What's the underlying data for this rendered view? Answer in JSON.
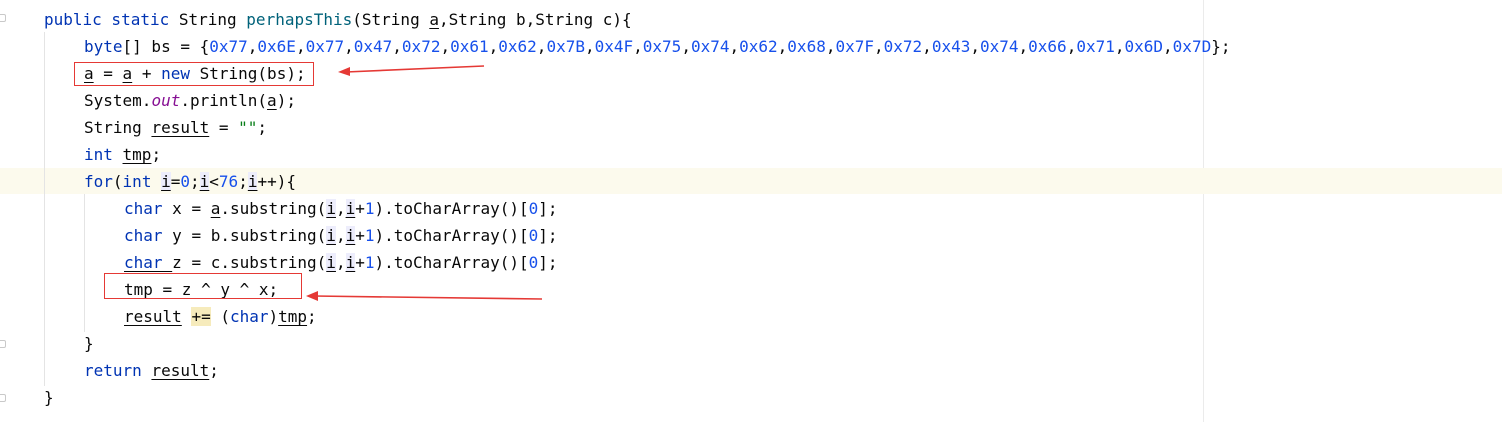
{
  "editor": {
    "lines": [
      {
        "id": "signature",
        "parts": [
          {
            "t": "public static ",
            "c": "kw"
          },
          {
            "t": "String ",
            "c": ""
          },
          {
            "t": "perhapsThis",
            "c": "fn"
          },
          {
            "t": "(String ",
            "c": ""
          },
          {
            "t": "a",
            "c": "ul"
          },
          {
            "t": ",String b,String c){",
            "c": ""
          }
        ]
      },
      {
        "id": "byte-array",
        "parts": [
          {
            "t": "byte",
            "c": "kw"
          },
          {
            "t": "[] bs = {",
            "c": ""
          },
          {
            "t": "0x77",
            "c": "num"
          },
          {
            "t": ",",
            "c": ""
          },
          {
            "t": "0x6E",
            "c": "num"
          },
          {
            "t": ",",
            "c": ""
          },
          {
            "t": "0x77",
            "c": "num"
          },
          {
            "t": ",",
            "c": ""
          },
          {
            "t": "0x47",
            "c": "num"
          },
          {
            "t": ",",
            "c": ""
          },
          {
            "t": "0x72",
            "c": "num"
          },
          {
            "t": ",",
            "c": ""
          },
          {
            "t": "0x61",
            "c": "num"
          },
          {
            "t": ",",
            "c": ""
          },
          {
            "t": "0x62",
            "c": "num"
          },
          {
            "t": ",",
            "c": ""
          },
          {
            "t": "0x7B",
            "c": "num"
          },
          {
            "t": ",",
            "c": ""
          },
          {
            "t": "0x4F",
            "c": "num"
          },
          {
            "t": ",",
            "c": ""
          },
          {
            "t": "0x75",
            "c": "num"
          },
          {
            "t": ",",
            "c": ""
          },
          {
            "t": "0x74",
            "c": "num"
          },
          {
            "t": ",",
            "c": ""
          },
          {
            "t": "0x62",
            "c": "num"
          },
          {
            "t": ",",
            "c": ""
          },
          {
            "t": "0x68",
            "c": "num"
          },
          {
            "t": ",",
            "c": ""
          },
          {
            "t": "0x7F",
            "c": "num"
          },
          {
            "t": ",",
            "c": ""
          },
          {
            "t": "0x72",
            "c": "num"
          },
          {
            "t": ",",
            "c": ""
          },
          {
            "t": "0x43",
            "c": "num"
          },
          {
            "t": ",",
            "c": ""
          },
          {
            "t": "0x74",
            "c": "num"
          },
          {
            "t": ",",
            "c": ""
          },
          {
            "t": "0x66",
            "c": "num"
          },
          {
            "t": ",",
            "c": ""
          },
          {
            "t": "0x71",
            "c": "num"
          },
          {
            "t": ",",
            "c": ""
          },
          {
            "t": "0x6D",
            "c": "num"
          },
          {
            "t": ",",
            "c": ""
          },
          {
            "t": "0x7D",
            "c": "num"
          },
          {
            "t": "};",
            "c": ""
          }
        ]
      },
      {
        "id": "assign-a",
        "parts": [
          {
            "t": "a",
            "c": "ul"
          },
          {
            "t": " = ",
            "c": ""
          },
          {
            "t": "a",
            "c": "ul"
          },
          {
            "t": " + ",
            "c": ""
          },
          {
            "t": "new ",
            "c": "kw"
          },
          {
            "t": "String(bs);",
            "c": ""
          }
        ]
      },
      {
        "id": "println",
        "parts": [
          {
            "t": "System.",
            "c": ""
          },
          {
            "t": "out",
            "c": "field"
          },
          {
            "t": ".println(",
            "c": ""
          },
          {
            "t": "a",
            "c": "ul"
          },
          {
            "t": ");",
            "c": ""
          }
        ]
      },
      {
        "id": "result-decl",
        "parts": [
          {
            "t": "String ",
            "c": ""
          },
          {
            "t": "result",
            "c": "ul"
          },
          {
            "t": " = ",
            "c": ""
          },
          {
            "t": "\"\"",
            "c": "str"
          },
          {
            "t": ";",
            "c": ""
          }
        ]
      },
      {
        "id": "tmp-decl",
        "parts": [
          {
            "t": "int ",
            "c": "kw"
          },
          {
            "t": "tmp",
            "c": "ul"
          },
          {
            "t": ";",
            "c": ""
          }
        ]
      },
      {
        "id": "for-loop",
        "parts": [
          {
            "t": "for",
            "c": "kw"
          },
          {
            "t": "(",
            "c": ""
          },
          {
            "t": "int ",
            "c": "kw"
          },
          {
            "t": "i",
            "c": "ul pill"
          },
          {
            "t": "=",
            "c": ""
          },
          {
            "t": "0",
            "c": "num"
          },
          {
            "t": ";",
            "c": ""
          },
          {
            "t": "i",
            "c": "ul pill"
          },
          {
            "t": "<",
            "c": ""
          },
          {
            "t": "76",
            "c": "num"
          },
          {
            "t": ";",
            "c": ""
          },
          {
            "t": "i",
            "c": "ul pill"
          },
          {
            "t": "++){",
            "c": ""
          }
        ]
      },
      {
        "id": "char-x",
        "parts": [
          {
            "t": "char ",
            "c": "kw"
          },
          {
            "t": "x = ",
            "c": ""
          },
          {
            "t": "a",
            "c": "ul"
          },
          {
            "t": ".substring(",
            "c": ""
          },
          {
            "t": "i",
            "c": "ul pill"
          },
          {
            "t": ",",
            "c": ""
          },
          {
            "t": "i",
            "c": "ul pill"
          },
          {
            "t": "+",
            "c": ""
          },
          {
            "t": "1",
            "c": "num"
          },
          {
            "t": ").toCharArray()[",
            "c": ""
          },
          {
            "t": "0",
            "c": "num"
          },
          {
            "t": "];",
            "c": ""
          }
        ]
      },
      {
        "id": "char-y",
        "parts": [
          {
            "t": "char ",
            "c": "kw"
          },
          {
            "t": "y = b.substring(",
            "c": ""
          },
          {
            "t": "i",
            "c": "ul pill"
          },
          {
            "t": ",",
            "c": ""
          },
          {
            "t": "i",
            "c": "ul pill"
          },
          {
            "t": "+",
            "c": ""
          },
          {
            "t": "1",
            "c": "num"
          },
          {
            "t": ").toCharArray()[",
            "c": ""
          },
          {
            "t": "0",
            "c": "num"
          },
          {
            "t": "];",
            "c": ""
          }
        ]
      },
      {
        "id": "char-z",
        "parts": [
          {
            "t": "char ",
            "c": "kw ul"
          },
          {
            "t": "z = c.substring(",
            "c": ""
          },
          {
            "t": "i",
            "c": "ul pill"
          },
          {
            "t": ",",
            "c": ""
          },
          {
            "t": "i",
            "c": "ul pill"
          },
          {
            "t": "+",
            "c": ""
          },
          {
            "t": "1",
            "c": "num"
          },
          {
            "t": ").toCharArray()[",
            "c": ""
          },
          {
            "t": "0",
            "c": "num"
          },
          {
            "t": "];",
            "c": ""
          }
        ]
      },
      {
        "id": "tmp-xor",
        "parts": [
          {
            "t": "tmp",
            "c": "ul"
          },
          {
            "t": " = z ^ y ^ x;",
            "c": ""
          }
        ]
      },
      {
        "id": "result-append",
        "parts": [
          {
            "t": "result",
            "c": "ul"
          },
          {
            "t": " ",
            "c": ""
          },
          {
            "t": "+=",
            "c": "hl"
          },
          {
            "t": " (",
            "c": ""
          },
          {
            "t": "char",
            "c": "kw"
          },
          {
            "t": ")",
            "c": ""
          },
          {
            "t": "tmp",
            "c": "ul"
          },
          {
            "t": ";",
            "c": ""
          }
        ]
      },
      {
        "id": "for-close",
        "parts": [
          {
            "t": "}",
            "c": ""
          }
        ]
      },
      {
        "id": "return",
        "parts": [
          {
            "t": "return ",
            "c": "kw"
          },
          {
            "t": "result",
            "c": "ul"
          },
          {
            "t": ";",
            "c": ""
          }
        ]
      },
      {
        "id": "method-close",
        "parts": [
          {
            "t": "}",
            "c": ""
          }
        ]
      }
    ]
  },
  "colors": {
    "keyword": "#0033b3",
    "number": "#1750eb",
    "string": "#067d17",
    "static_field": "#871094",
    "method_name": "#00627a",
    "annotation_red": "#e53935",
    "caret_line": "#fcfaed"
  }
}
